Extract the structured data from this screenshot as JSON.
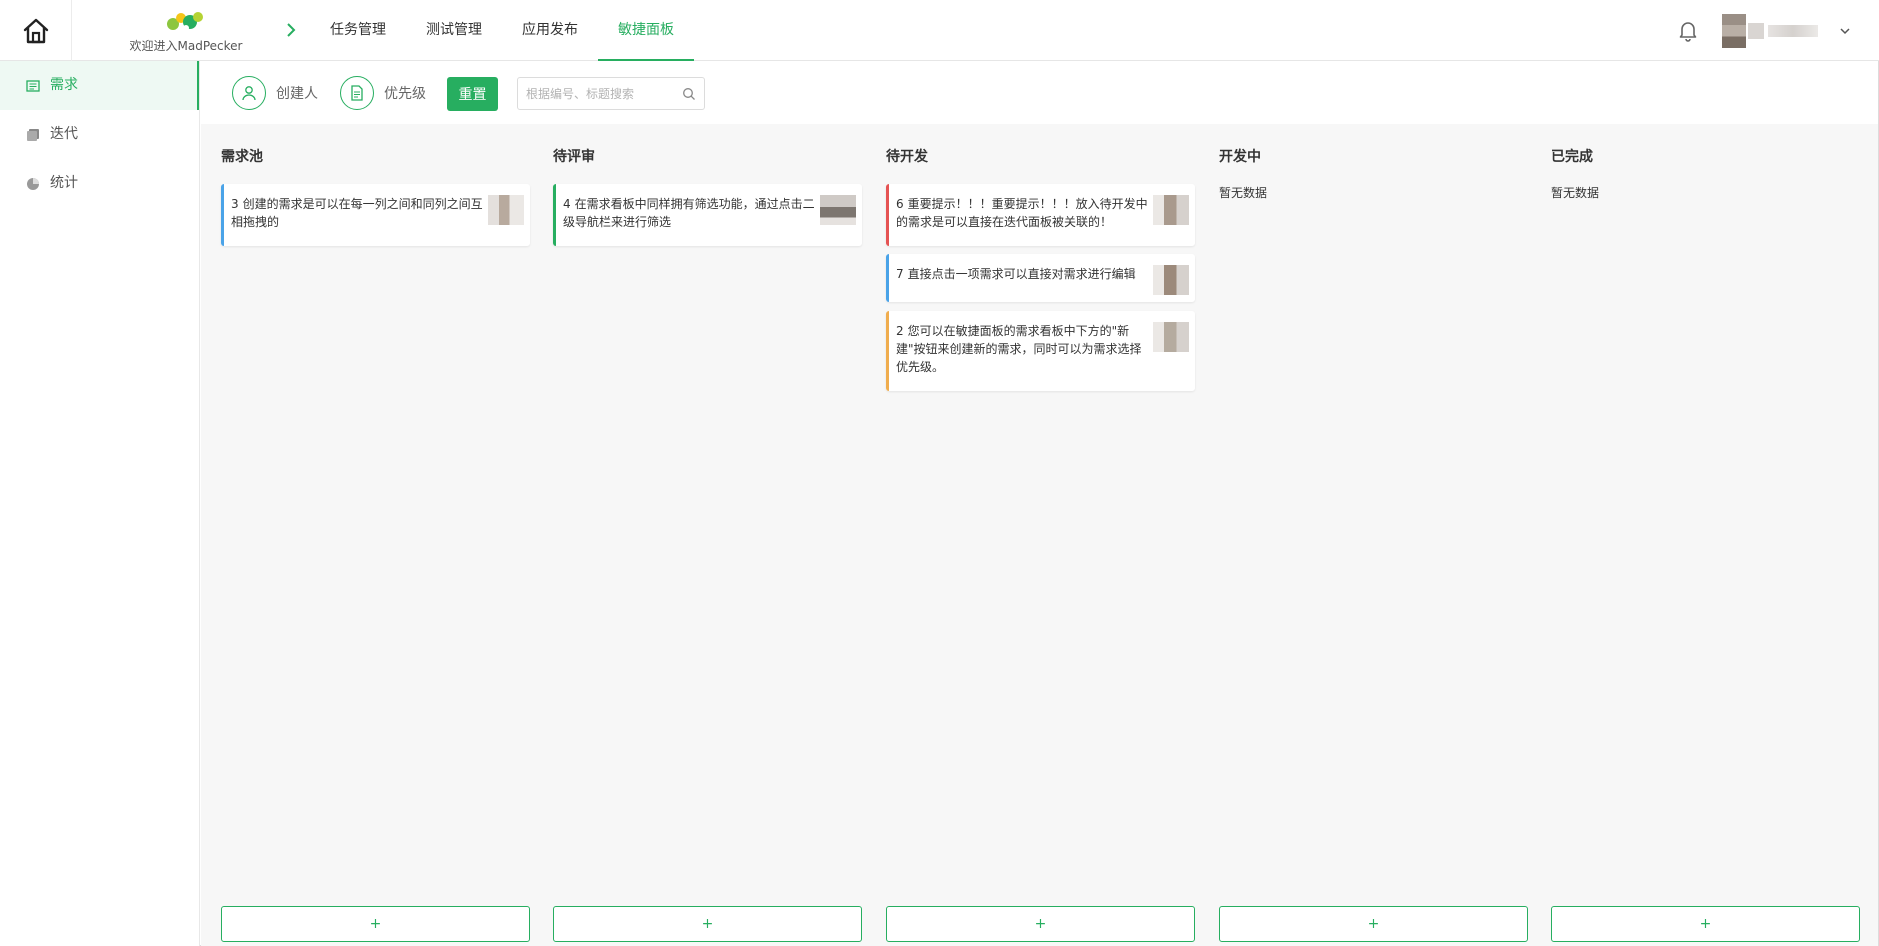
{
  "app": {
    "welcome": "欢迎进入MadPecker"
  },
  "nav": {
    "items": [
      {
        "label": "任务管理",
        "active": false
      },
      {
        "label": "测试管理",
        "active": false
      },
      {
        "label": "应用发布",
        "active": false
      },
      {
        "label": "敏捷面板",
        "active": true
      }
    ]
  },
  "sidebar": {
    "items": [
      {
        "label": "需求",
        "icon": "list-icon",
        "active": true
      },
      {
        "label": "迭代",
        "icon": "stack-icon",
        "active": false
      },
      {
        "label": "统计",
        "icon": "pie-chart-icon",
        "active": false
      }
    ]
  },
  "filters": {
    "creator_label": "创建人",
    "priority_label": "优先级",
    "reset_label": "重置",
    "search_placeholder": "根据编号、标题搜索"
  },
  "colors": {
    "accent": "#27ae60",
    "blue": "#4aa3e8",
    "red": "#e55353",
    "yellow": "#f0ad4e",
    "green": "#27ae60"
  },
  "columns": [
    {
      "title": "需求池",
      "empty_text": "",
      "cards": [
        {
          "id": "3",
          "text": "创建的需求是可以在每一列之间和同列之间互相拖拽的",
          "priority_color": "blue"
        }
      ],
      "add_label": "+"
    },
    {
      "title": "待评审",
      "empty_text": "",
      "cards": [
        {
          "id": "4",
          "text": "在需求看板中同样拥有筛选功能，通过点击二级导航栏来进行筛选",
          "priority_color": "green"
        }
      ],
      "add_label": "+"
    },
    {
      "title": "待开发",
      "empty_text": "",
      "cards": [
        {
          "id": "6",
          "text": "重要提示！！！重要提示！！！放入待开发中的需求是可以直接在迭代面板被关联的！",
          "priority_color": "red"
        },
        {
          "id": "7",
          "text": "直接点击一项需求可以直接对需求进行编辑",
          "priority_color": "blue"
        },
        {
          "id": "2",
          "text": "您可以在敏捷面板的需求看板中下方的\"新建\"按钮来创建新的需求，同时可以为需求选择优先级。",
          "priority_color": "yellow"
        }
      ],
      "add_label": "+"
    },
    {
      "title": "开发中",
      "empty_text": "暂无数据",
      "cards": [],
      "add_label": "+"
    },
    {
      "title": "已完成",
      "empty_text": "暂无数据",
      "cards": [],
      "add_label": "+"
    }
  ]
}
